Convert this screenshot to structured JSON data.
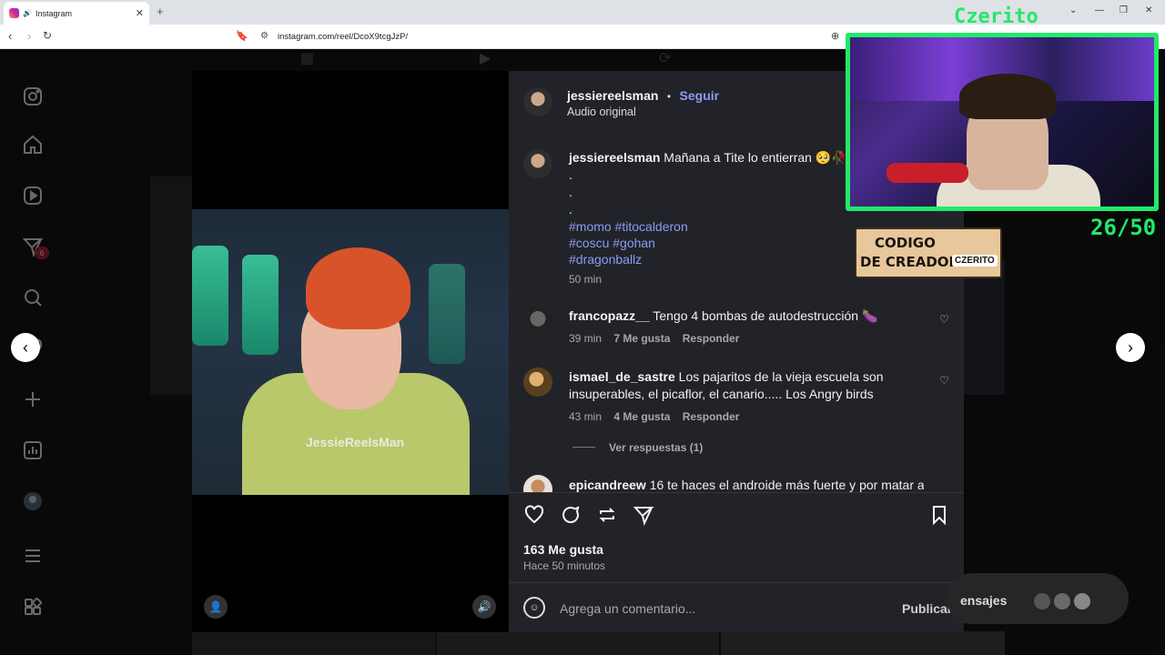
{
  "browser": {
    "tab_title": "Instagram",
    "url": "instagram.com/reel/DcoX9tcgJzP/"
  },
  "sidebar": {
    "notifications_badge": "6"
  },
  "post": {
    "author": "jessiereelsman",
    "follow_label": "Seguir",
    "audio": "Audio original",
    "caption": {
      "author": "jessiereelsman",
      "text": "Mañana a Tite lo entierran 🥺🥀",
      "dots": [
        ".",
        ".",
        "."
      ],
      "hashtags_line1": "#momo #titocalderon",
      "hashtags_line2": "#coscu #gohan",
      "hashtags_line3": "#dragonballz",
      "time": "50 min"
    },
    "comments": [
      {
        "user": "francopazz__",
        "text": "Tengo 4 bombas de autodestrucción 🍆",
        "time": "39 min",
        "likes": "7 Me gusta",
        "reply": "Responder"
      },
      {
        "user": "ismael_de_sastre",
        "text": "Los pajaritos de la vieja escuela son insuperables, el picaflor, el canario..... Los Angry birds",
        "time": "43 min",
        "likes": "4 Me gusta",
        "reply": "Responder",
        "view_replies": "Ver respuestas (1)"
      },
      {
        "user": "epicandreew",
        "text": "16 te haces el androide más fuerte y por matar a"
      }
    ],
    "like_count": "163 Me gusta",
    "posted_ago": "Hace 50 minutos",
    "comment_placeholder": "Agrega un comentario...",
    "publish_label": "Publicar",
    "video_watermark": "JessieReelsMan"
  },
  "stream_overlay": {
    "streamer_name": "Czerito",
    "counter": "26/50",
    "creator_code_line1": "CODIGO",
    "creator_code_line2": "DE CREADOR",
    "creator_code_name": "CZERITO"
  },
  "messages_label": "ensajes"
}
